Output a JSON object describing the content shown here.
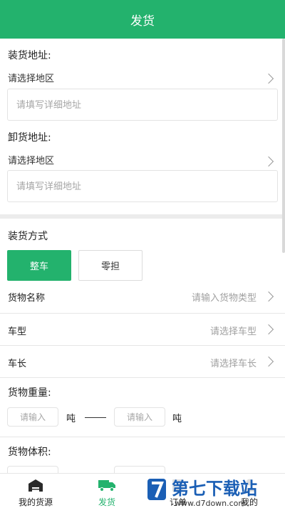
{
  "header": {
    "title": "发货"
  },
  "loading": {
    "label": "装货地址:",
    "region_placeholder": "请选择地区",
    "detail_placeholder": "请填写详细地址"
  },
  "unloading": {
    "label": "卸货地址:",
    "region_placeholder": "请选择地区",
    "detail_placeholder": "请填写详细地址"
  },
  "load_method": {
    "label": "装货方式",
    "options": [
      "整车",
      "零担"
    ],
    "selected": "整车"
  },
  "rows": [
    {
      "label": "货物名称",
      "placeholder": "请输入货物类型"
    },
    {
      "label": "车型",
      "placeholder": "请选择车型"
    },
    {
      "label": "车长",
      "placeholder": "请选择车长"
    }
  ],
  "weight": {
    "label": "货物重量:",
    "min_placeholder": "请输入",
    "max_placeholder": "请输入",
    "unit": "吨"
  },
  "volume": {
    "label": "货物体积:"
  },
  "tabbar": {
    "items": [
      "我的货源",
      "发货",
      "订单",
      "我的"
    ],
    "active": "发货"
  },
  "watermark": {
    "text": "第七下载站",
    "url": "www.d7down.com"
  },
  "colors": {
    "brand": "#23b26d",
    "divider": "#e6e6e6"
  }
}
